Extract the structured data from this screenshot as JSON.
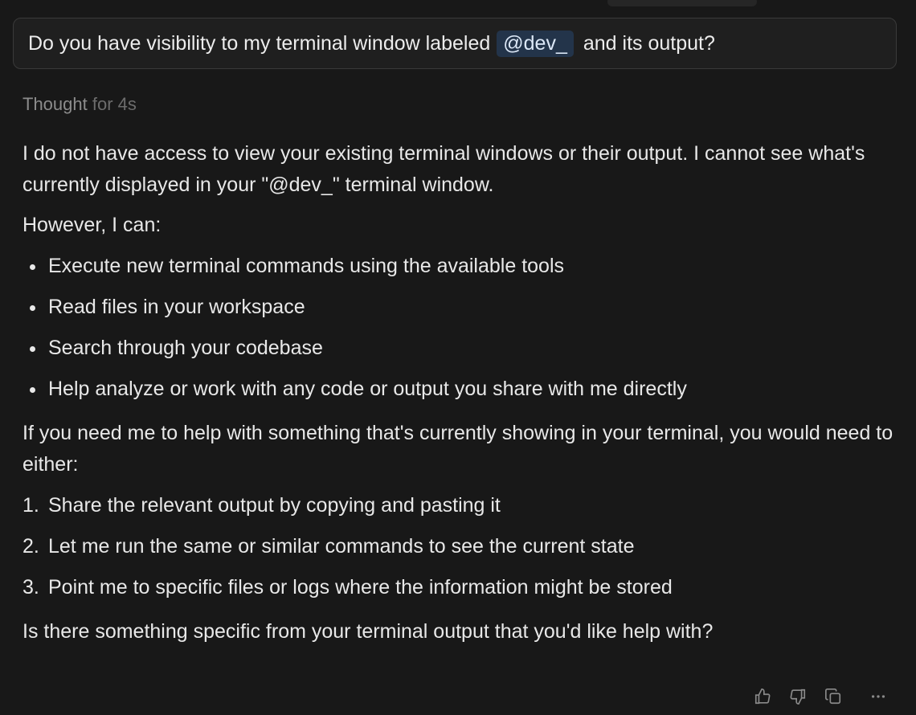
{
  "query": {
    "text_before": "Do you have visibility to my terminal window labeled",
    "mention": "@dev_",
    "text_after": "and its output?"
  },
  "thought": {
    "label": "Thought",
    "duration": "for 4s"
  },
  "answer": {
    "intro": "I do not have access to view your existing terminal windows or their output. I cannot see what's currently displayed in your \"@dev_\" terminal window.",
    "however": "However, I can:",
    "capabilities": [
      "Execute new terminal commands using the available tools",
      "Read files in your workspace",
      "Search through your codebase",
      "Help analyze or work with any code or output you share with me directly"
    ],
    "need": "If you need me to help with something that's currently showing in your terminal, you would need to either:",
    "options": [
      {
        "num": "1.",
        "text": "Share the relevant output by copying and pasting it"
      },
      {
        "num": "2.",
        "text": "Let me run the same or similar commands to see the current state"
      },
      {
        "num": "3.",
        "text": "Point me to specific files or logs where the information might be stored"
      }
    ],
    "closing": "Is there something specific from your terminal output that you'd like help with?"
  },
  "actions": {
    "icons": [
      "thumbs-up-icon",
      "thumbs-down-icon",
      "copy-icon",
      "more-icon"
    ],
    "icon_color": "#8a8a8a"
  }
}
